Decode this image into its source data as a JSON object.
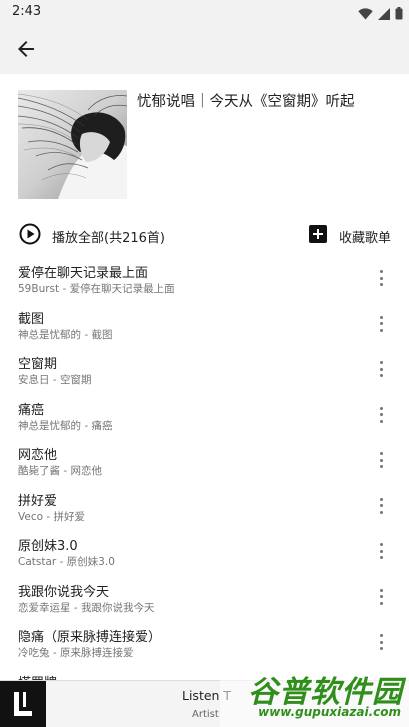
{
  "status_bar": {
    "time": "2:43"
  },
  "playlist": {
    "title": "忧郁说唱｜今天从《空窗期》听起",
    "play_all_label": "播放全部(共216首)",
    "collect_label": "收藏歌单"
  },
  "songs": [
    {
      "title": "爱停在聊天记录最上面",
      "subtitle": "59Burst - 爱停在聊天记录最上面"
    },
    {
      "title": "截图",
      "subtitle": "神总是忧郁的 - 截图"
    },
    {
      "title": "空窗期",
      "subtitle": "安息日 - 空窗期"
    },
    {
      "title": "痛癌",
      "subtitle": "神总是忧郁的 - 痛癌"
    },
    {
      "title": "网恋他",
      "subtitle": "酷毙了酱 - 网恋他"
    },
    {
      "title": "拼好爱",
      "subtitle": "Veco - 拼好爱"
    },
    {
      "title": "原创妹3.0",
      "subtitle": "Catstar - 原创妹3.0"
    },
    {
      "title": "我跟你说我今天",
      "subtitle": "恋爱幸运星 - 我跟你说我今天"
    },
    {
      "title": "隐痛（原来脉搏连接爱）",
      "subtitle": "冷吃兔 - 原来脉搏连接爱"
    },
    {
      "title": "塔罗牌",
      "subtitle": ""
    }
  ],
  "mini_player": {
    "title": "Listen T",
    "artist": "Artist"
  },
  "watermark": {
    "text": "谷普软件园",
    "url": "www.gupuxiazai.com"
  }
}
